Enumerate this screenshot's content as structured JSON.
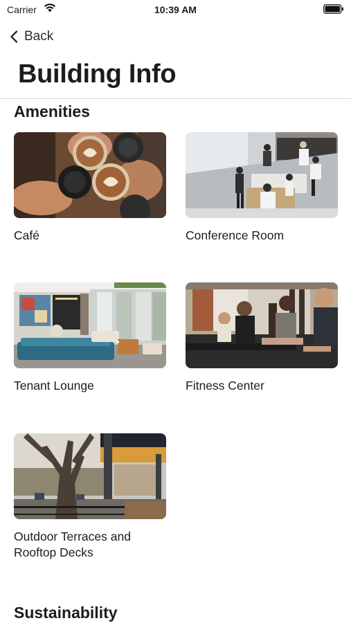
{
  "status_bar": {
    "carrier": "Carrier",
    "time": "10:39 AM"
  },
  "nav": {
    "back_label": "Back",
    "title": "Building Info"
  },
  "sections": {
    "amenities_title": "Amenities",
    "sustainability_title": "Sustainability"
  },
  "amenities": [
    {
      "label": "Café",
      "icon": "cafe-photo"
    },
    {
      "label": "Conference Room",
      "icon": "conference-room-photo"
    },
    {
      "label": "Tenant Lounge",
      "icon": "lounge-photo"
    },
    {
      "label": "Fitness Center",
      "icon": "fitness-photo"
    },
    {
      "label": "Outdoor Terraces and Rooftop Decks",
      "icon": "terrace-photo"
    }
  ],
  "colors": {
    "text": "#1c1c1e",
    "divider": "#d6d6d8",
    "background": "#ffffff"
  }
}
